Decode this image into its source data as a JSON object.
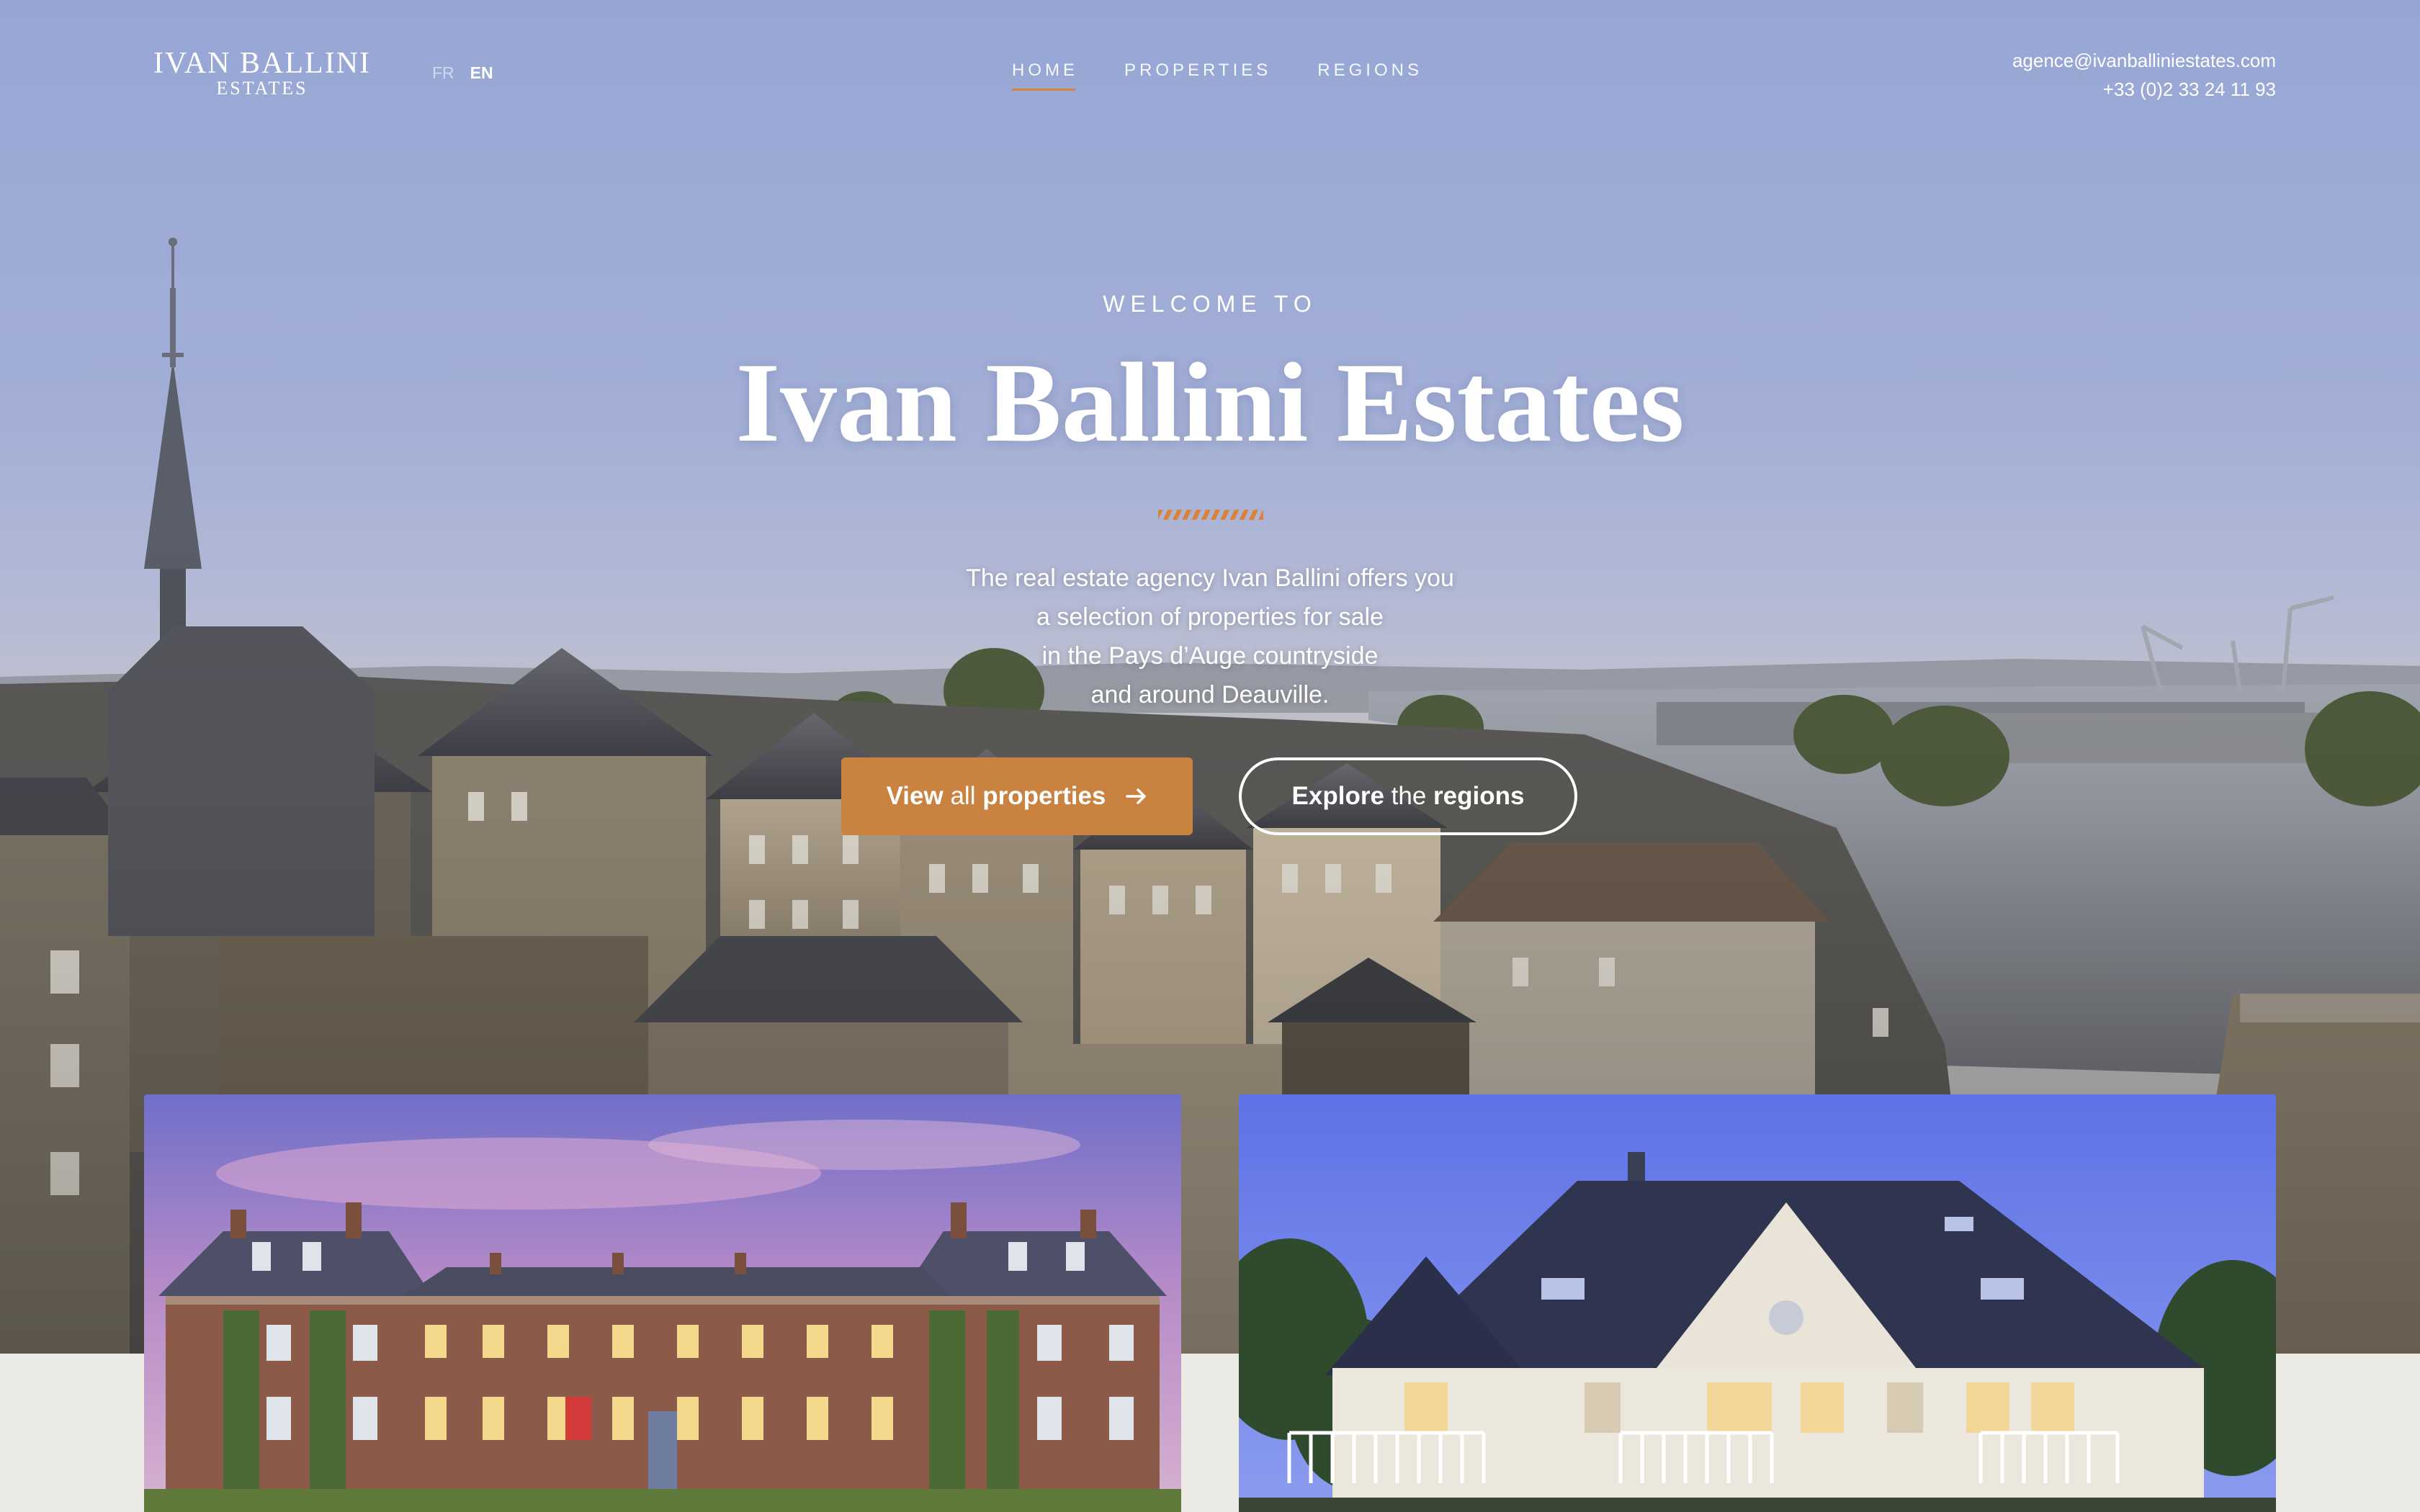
{
  "header": {
    "logo": {
      "line1": "IVAN BALLINI",
      "line2": "ESTATES"
    },
    "languages": [
      {
        "label": "FR",
        "active": false
      },
      {
        "label": "EN",
        "active": true
      }
    ],
    "nav": [
      {
        "label": "HOME",
        "current": true
      },
      {
        "label": "PROPERTIES",
        "current": false
      },
      {
        "label": "REGIONS",
        "current": false
      }
    ],
    "contact": {
      "email": "agence@ivanballiniestates.com",
      "phone": "+33 (0)2 33 24 11 93"
    }
  },
  "hero": {
    "eyebrow": "WELCOME TO",
    "title": "Ivan Ballini Estates",
    "intro_lines": [
      "The real estate agency Ivan Ballini offers you",
      "a selection of properties for sale",
      "in the Pays d’Auge countryside",
      "and around Deauville."
    ],
    "primary_button": {
      "strong1": "View",
      "light": "all",
      "strong2": "properties",
      "icon": "arrow-right-icon"
    },
    "secondary_button": {
      "strong1": "Explore",
      "light": "the",
      "strong2": "regions"
    }
  },
  "colors": {
    "accent": "#d9823c",
    "button": "#c98240",
    "page_bg": "#eceae4"
  }
}
